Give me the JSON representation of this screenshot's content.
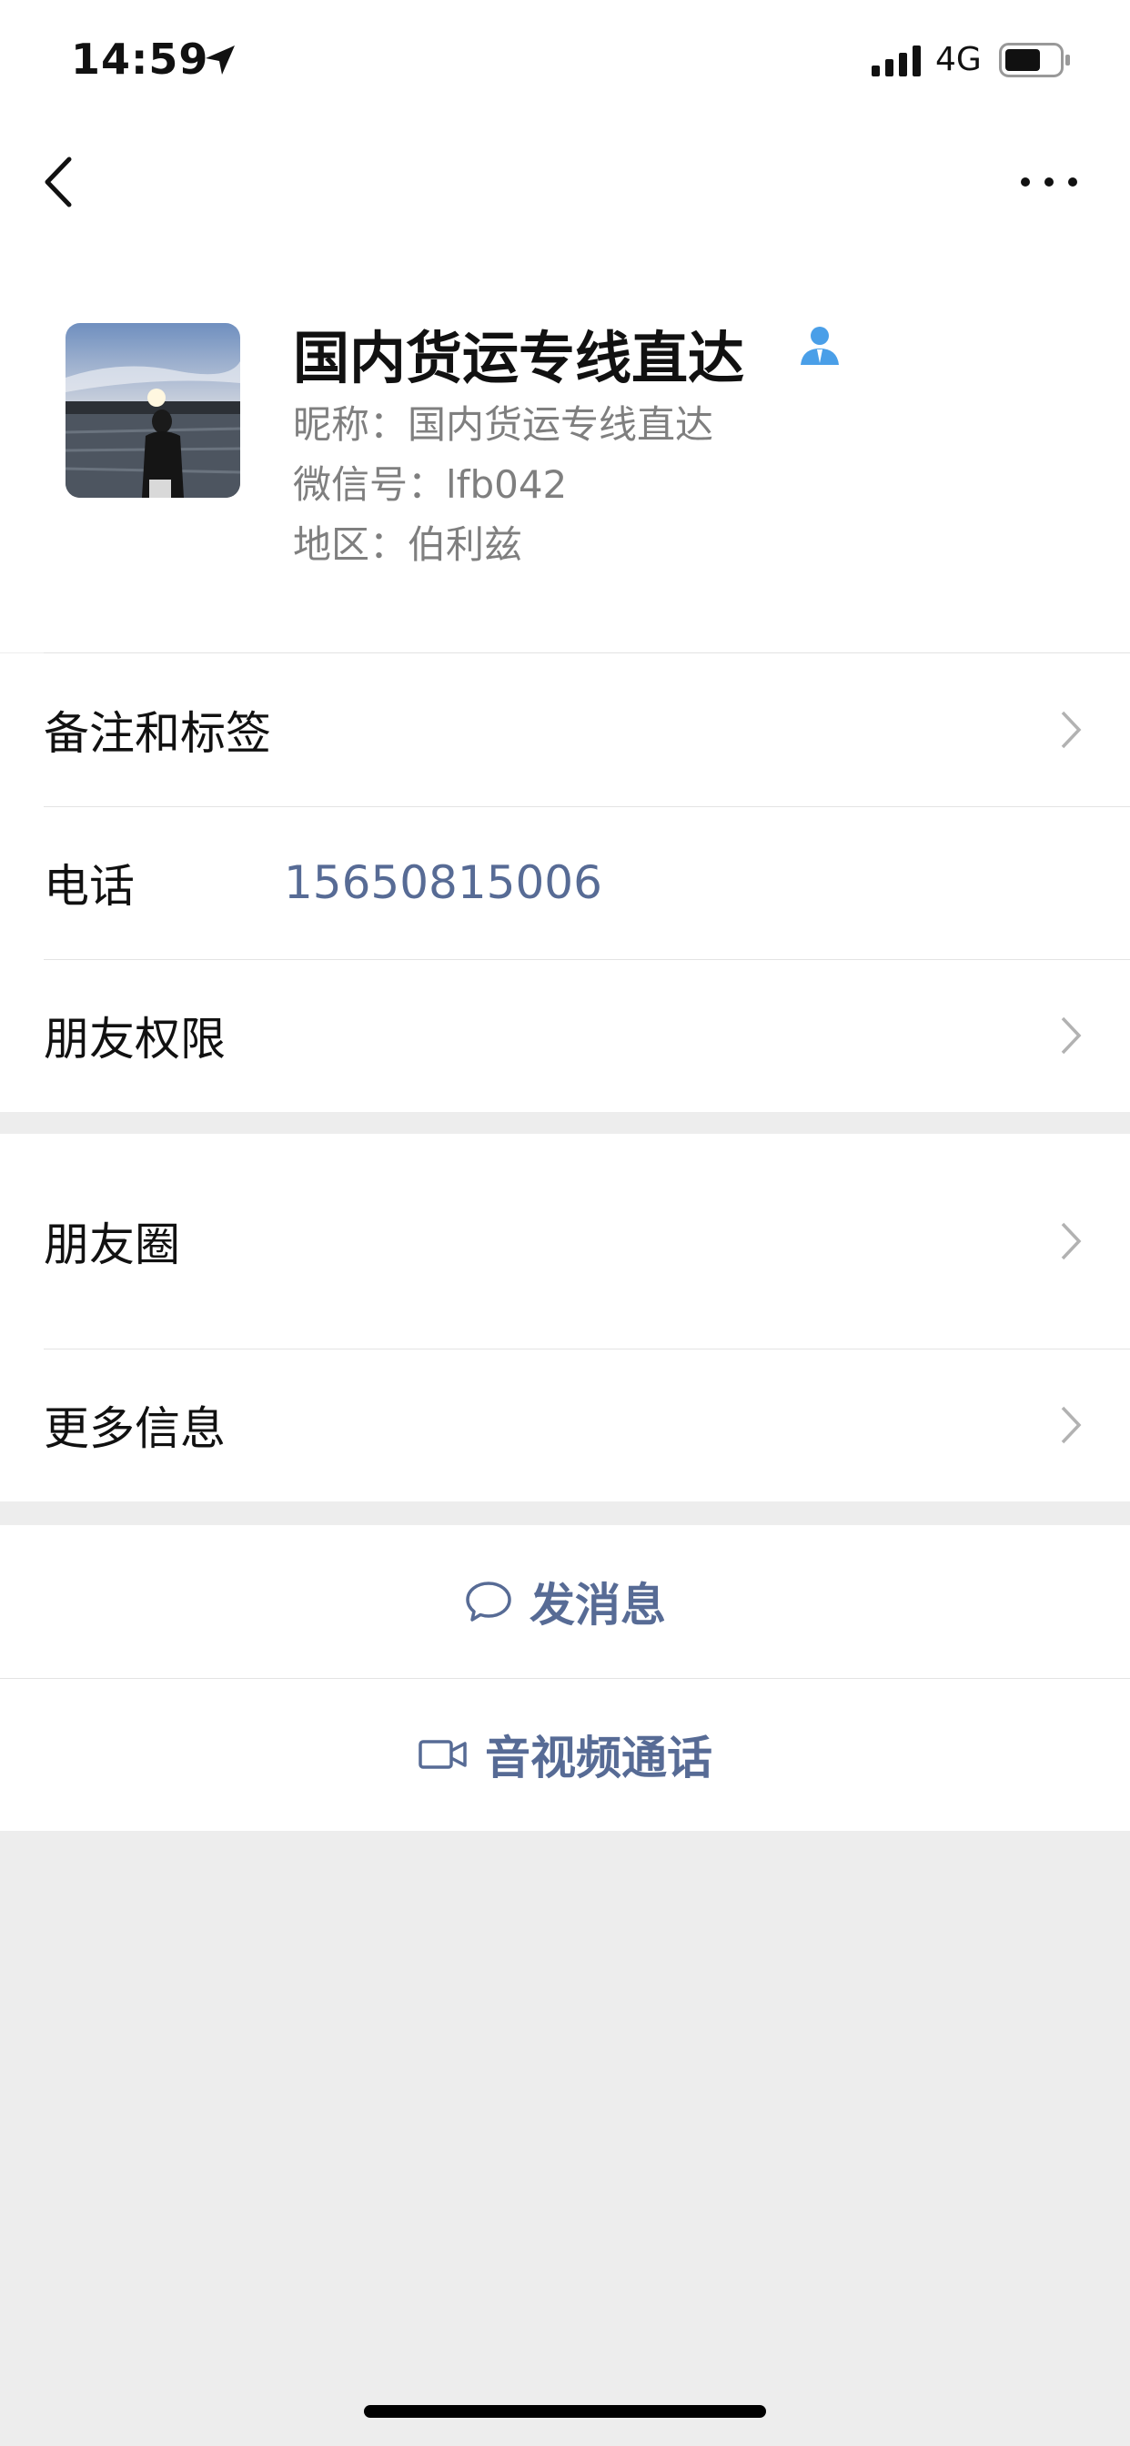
{
  "status_bar": {
    "time": "14:59",
    "network": "4G"
  },
  "profile": {
    "name": "国内货运专线直达",
    "nickname": "昵称：国内货运专线直达",
    "wechat_id": "微信号：lfb042",
    "region": "地区：伯利兹"
  },
  "section1": {
    "remark_label": "备注和标签",
    "phone_label": "电话",
    "phone_value": "15650815006",
    "permissions_label": "朋友权限"
  },
  "section2": {
    "moments_label": "朋友圈",
    "more_info_label": "更多信息"
  },
  "actions": {
    "message_label": "发消息",
    "call_label": "音视频通话"
  },
  "colors": {
    "link": "#576b95",
    "background": "#ededed",
    "badge": "#4a9fe8"
  }
}
